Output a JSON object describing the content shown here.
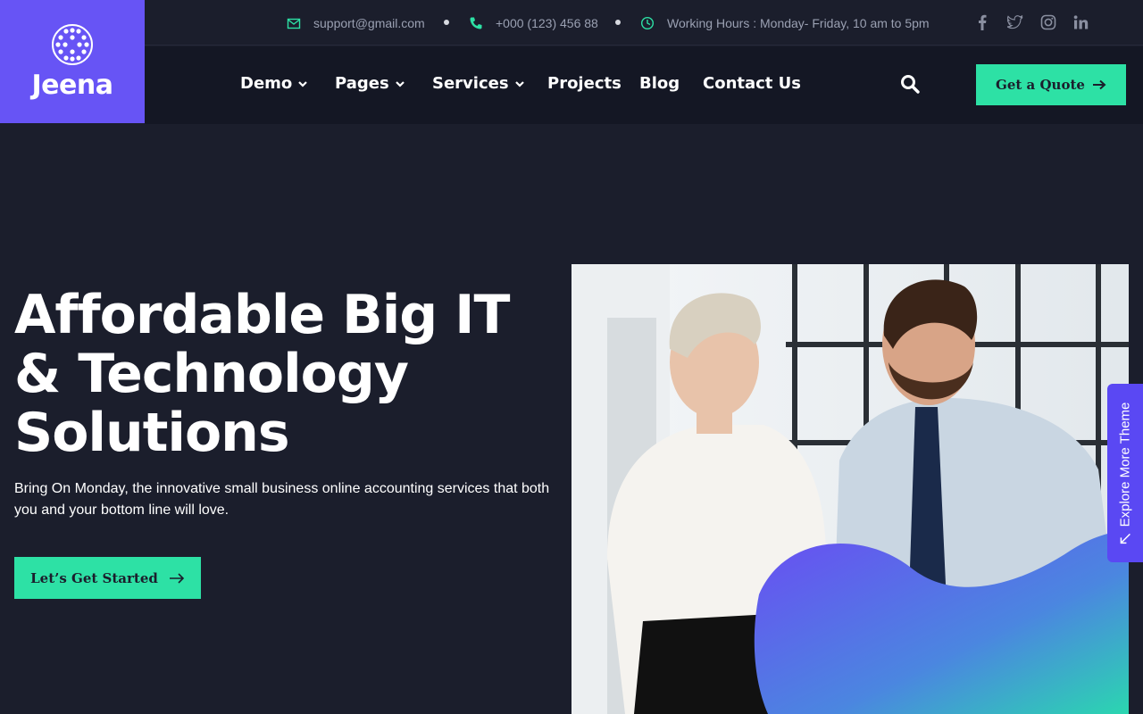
{
  "brand": {
    "name": "Jeena",
    "logo_icon": "dotted-globe-icon",
    "color": "#6754f5"
  },
  "topbar": {
    "email": "support@gmail.com",
    "phone": "+000 (123) 456 88",
    "hours": "Working Hours : Monday- Friday, 10 am to 5pm",
    "icons": {
      "email": "envelope-icon",
      "phone": "phone-icon",
      "hours": "clock-icon"
    },
    "socials": [
      "facebook",
      "twitter",
      "instagram",
      "linkedin"
    ]
  },
  "nav": {
    "items": [
      {
        "label": "Demo",
        "dropdown": true
      },
      {
        "label": "Pages",
        "dropdown": true
      },
      {
        "label": "Services",
        "dropdown": true
      },
      {
        "label": "Projects",
        "dropdown": false
      },
      {
        "label": "Blog",
        "dropdown": false
      },
      {
        "label": "Contact Us",
        "dropdown": false
      }
    ],
    "quote_label": "Get a Quote"
  },
  "hero": {
    "title_lines": [
      "Affordable Big IT",
      "& Technology",
      "Solutions"
    ],
    "subtitle": "Bring On Monday, the innovative small business online accounting services that both you and your bottom line will love.",
    "cta_label": "Let’s Get Started"
  },
  "side_tab": {
    "label": "Explore More Theme"
  },
  "colors": {
    "accent": "#2de1a5",
    "brand": "#6754f5",
    "background": "#1b1e2c",
    "nav_background": "#141724"
  }
}
